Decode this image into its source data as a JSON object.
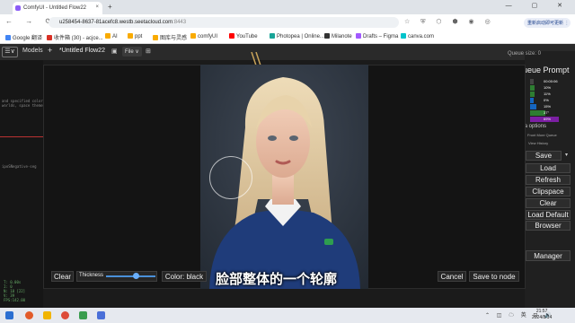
{
  "browser": {
    "tab_title": "ComfyUI - Untitled Flow22",
    "tab_close": "×",
    "new_tab": "+",
    "window_controls": "— ▢ ✕",
    "nav": "← → ⟳",
    "url_host": "u258454-8637-81acefc8.westb.seetacloud.com",
    "url_port": ":8443",
    "extension_icons": "☆ ⛨ ⬡ ⬢ ◉ ◎",
    "update_button": "重新启动即可更新 ⋮",
    "bookmarks": [
      {
        "label": "Google 翻译",
        "color": "#4285f4"
      },
      {
        "label": "收件箱 (30) - acjce...",
        "color": "#d93025"
      },
      {
        "label": "AI",
        "color": "#f9ab00"
      },
      {
        "label": "ppt",
        "color": "#f9ab00"
      },
      {
        "label": "图库与灵感",
        "color": "#f9ab00"
      },
      {
        "label": "comfyUI",
        "color": "#f9ab00"
      },
      {
        "label": "YouTube",
        "color": "#ff0000"
      },
      {
        "label": "Photopea | Online...",
        "color": "#18a497"
      },
      {
        "label": "Milanote",
        "color": "#333333"
      },
      {
        "label": "Drafts – Figma",
        "color": "#a259ff"
      },
      {
        "label": "canva.com",
        "color": "#00c4cc"
      }
    ]
  },
  "menubar": {
    "models": "Models",
    "plus": "+",
    "flow_title": "*Untitled Flow22",
    "file": "File ∨",
    "image_icon": "▣",
    "save_icon": "⊞",
    "menu_icon": "☰∨"
  },
  "left_panel": {
    "code_lines": [
      "and specified color)",
      "worlds, space themes, ...",
      "ipoSNegative-seg"
    ],
    "stats": [
      "T: 0.00s",
      "I: 0",
      "N: 18 [22]",
      "V: 39",
      "FPS:142.00"
    ]
  },
  "queue": {
    "size_label": "Queue size: 0",
    "prompt_label": "Queue Prompt",
    "rows": [
      {
        "value": "00:00:06",
        "pct": 0,
        "color": "#444444"
      },
      {
        "value": "10%",
        "pct": 10,
        "color": "#2e7d32"
      },
      {
        "value": "11%",
        "pct": 11,
        "color": "#2e7d32"
      },
      {
        "value": "0%",
        "pct": 0,
        "color": "#1565c0"
      },
      {
        "value": "15%",
        "pct": 15,
        "color": "#1565c0"
      },
      {
        "value": "37°",
        "pct": 37,
        "color": "#2e7d32"
      },
      {
        "value": "69%",
        "pct": 69,
        "color": "#7b1fa2"
      }
    ],
    "extra_options": "Extra options",
    "history_buttons": "Front   More Queue",
    "view_history": "View History",
    "save": "Save",
    "save_arrow": "▾",
    "load": "Load",
    "refresh": "Refresh",
    "clipspace": "Clipspace",
    "clear": "Clear",
    "load_default": "Load Default",
    "browser": "Browser",
    "manager": "Manager"
  },
  "mask_editor": {
    "clear": "Clear",
    "thickness_label": "Thickness",
    "thickness_level": 0.6,
    "color_button": "Color: black",
    "cancel": "Cancel",
    "save_to_node": "Save to node",
    "subtitle": "脸部整体的一个轮廓"
  },
  "taskbar": {
    "tray": "⌃ ◫ ☁ 英 ⊡ 🔊",
    "time": "21:57",
    "date": "2024/8/14"
  }
}
